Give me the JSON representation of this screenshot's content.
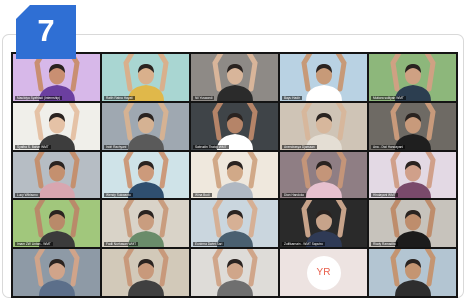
{
  "badge": {
    "number": "7",
    "color": "#2f6fd4"
  },
  "tiles": [
    {
      "name": "Maulidya Syafriadi (Internship)",
      "bg": "#d7b8e9",
      "skin": "#c98f72",
      "shirt": "#6b3fa0"
    },
    {
      "name": "Ratih Ratna Hayati",
      "bg": "#a9d6d2",
      "skin": "#d9b08c",
      "shirt": "#e0b84a"
    },
    {
      "name": "Nil Yuswardi",
      "bg": "#8e8a86",
      "skin": "#d8b59a",
      "shirt": "#2b2b2b"
    },
    {
      "name": "Bayu Hadir",
      "bg": "#b9d2e3",
      "skin": "#c79a78",
      "shirt": "#ffffff"
    },
    {
      "name": "Mutiara sulityah WMT",
      "bg": "#8db77b",
      "skin": "#cfa183",
      "shirt": "#2c3e50"
    },
    {
      "name": "Syafira S. Bahar WMT",
      "bg": "#f0efea",
      "skin": "#e5c2a6",
      "shirt": "#3d3d3d"
    },
    {
      "name": "Indri Rachyani",
      "bg": "#9fa8b1",
      "skin": "#d5b293",
      "shirt": "#5a5a5a"
    },
    {
      "name": "Sabrudin Tiratoji WMT",
      "bg": "#3f4448",
      "skin": "#b58468",
      "shirt": "#ffffff"
    },
    {
      "name": "Anendrasya Djamaan",
      "bg": "#cfc4b6",
      "skin": "#d7b79c",
      "shirt": "#e4ded4"
    },
    {
      "name": "Ana - Dwi Handayani",
      "bg": "#6e6a64",
      "skin": "#c89a7b",
      "shirt": "#1f1f1f"
    },
    {
      "name": "Lucy Wibisono",
      "bg": "#b6bdc4",
      "skin": "#c4906f",
      "shirt": "#d8a6b0"
    },
    {
      "name": "Wendy Sukwanto",
      "bg": "#cfe3e8",
      "skin": "#cc9a7b",
      "shirt": "#2f4f6f"
    },
    {
      "name": "Wina Budi",
      "bg": "#efe8dd",
      "skin": "#d1a988",
      "shirt": "#b0b8c2"
    },
    {
      "name": "Dian Handoko",
      "bg": "#8f7e84",
      "skin": "#c49579",
      "shirt": "#e7c1cf"
    },
    {
      "name": "Hindayani WMT",
      "bg": "#e3d9e4",
      "skin": "#d0a08a",
      "shirt": "#7a4a6b"
    },
    {
      "name": "Imam ZW Lintan - WMT",
      "bg": "#a1c77c",
      "skin": "#b98a6a",
      "shirt": "#3b3b3b"
    },
    {
      "name": "Fadli Nurhasan WMT",
      "bg": "#d9d3c8",
      "skin": "#c99d7f",
      "shirt": "#6a8c6a"
    },
    {
      "name": "Eunirma Dwiet Sari",
      "bg": "#cad6de",
      "skin": "#d6b095",
      "shirt": "#4a6070"
    },
    {
      "name": "Zulfikarnain - WMT Saputro",
      "bg": "#2a2a2a",
      "skin": "#c7a38a",
      "shirt": "#2f3a55"
    },
    {
      "name": "Riady Ramadita",
      "bg": "#c7c3bc",
      "skin": "#be8d6c",
      "shirt": "#1c1c1c"
    },
    {
      "name": "",
      "bg": "#8e9aa6",
      "skin": "#d0a48a",
      "shirt": "#5c6f8a"
    },
    {
      "name": "",
      "bg": "#d2c9b9",
      "skin": "#c8997b",
      "shirt": "#404040"
    },
    {
      "name": "",
      "bg": "#dedcd8",
      "skin": "#d0a68a",
      "shirt": "#6f6f6f"
    },
    {
      "name": "",
      "bg": "#ede3e1",
      "initials": "YR"
    },
    {
      "name": "",
      "bg": "#b3c5d2",
      "skin": "#c49572",
      "shirt": "#2e2e2e"
    }
  ]
}
